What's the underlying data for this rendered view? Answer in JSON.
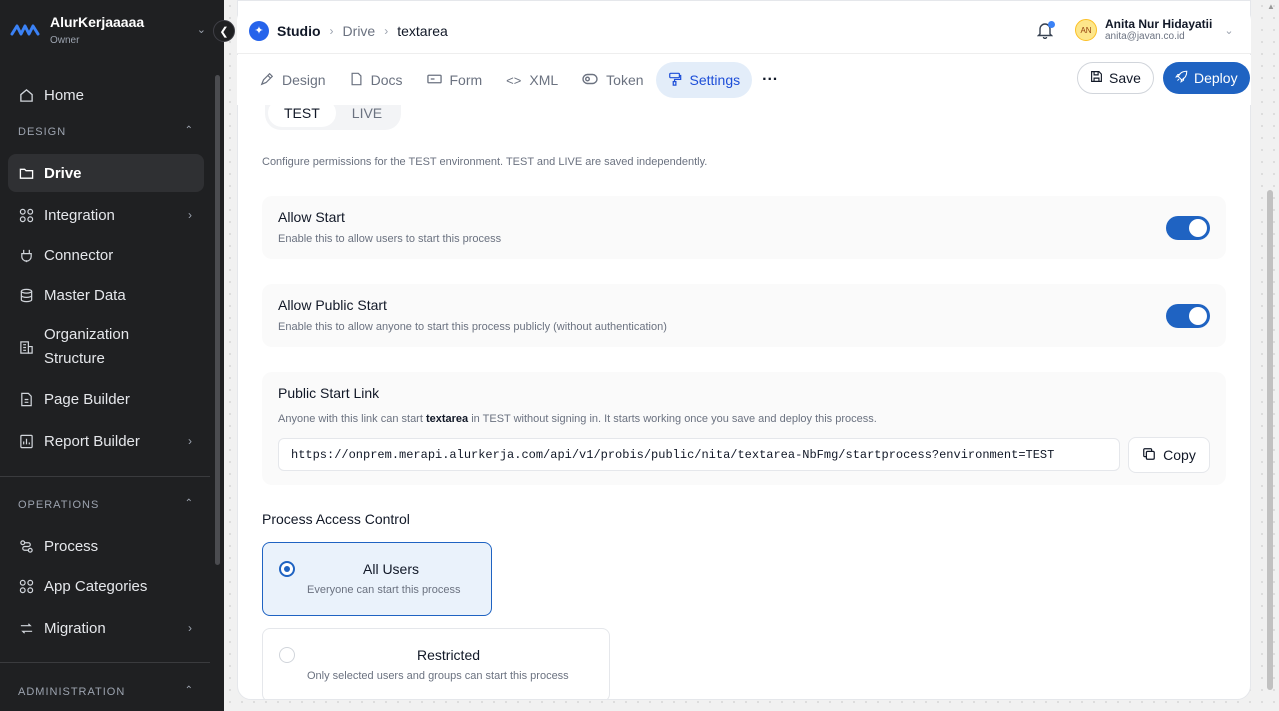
{
  "org": {
    "name": "AlurKerjaaaaa",
    "role": "Owner"
  },
  "sidebar": {
    "home": "Home",
    "design_label": "DESIGN",
    "design_items": [
      {
        "label": "Drive"
      },
      {
        "label": "Integration"
      },
      {
        "label": "Connector"
      },
      {
        "label": "Master Data"
      },
      {
        "label": "Organization Structure"
      },
      {
        "label": "Page Builder"
      },
      {
        "label": "Report Builder"
      }
    ],
    "operations_label": "OPERATIONS",
    "operations_items": [
      {
        "label": "Process"
      },
      {
        "label": "App Categories"
      },
      {
        "label": "Migration"
      }
    ],
    "administration_label": "ADMINISTRATION"
  },
  "breadcrumb": {
    "root": "Studio",
    "parent": "Drive",
    "current": "textarea"
  },
  "user": {
    "name": "Anita Nur Hidayatii",
    "email": "anita@javan.co.id",
    "initials": "AN"
  },
  "tabs": [
    {
      "label": "Design"
    },
    {
      "label": "Docs"
    },
    {
      "label": "Form"
    },
    {
      "label": "XML"
    },
    {
      "label": "Token"
    },
    {
      "label": "Settings"
    }
  ],
  "actions": {
    "save": "Save",
    "deploy": "Deploy"
  },
  "env": {
    "test": "TEST",
    "live": "LIVE"
  },
  "description": "Configure permissions for the TEST environment. TEST and LIVE are saved independently.",
  "allow_start": {
    "title": "Allow Start",
    "subtitle": "Enable this to allow users to start this process",
    "enabled": true
  },
  "allow_public_start": {
    "title": "Allow Public Start",
    "subtitle": "Enable this to allow anyone to start this process publicly (without authentication)",
    "enabled": true
  },
  "public_link": {
    "title": "Public Start Link",
    "subtitle_pre": "Anyone with this link can start ",
    "subtitle_bold": "textarea",
    "subtitle_post": " in TEST without signing in. It starts working once you save and deploy this process.",
    "url": "https://onprem.merapi.alurkerja.com/api/v1/probis/public/nita/textarea-NbFmg/startprocess?environment=TEST",
    "copy": "Copy"
  },
  "access_control": {
    "title": "Process Access Control",
    "options": [
      {
        "title": "All Users",
        "subtitle": "Everyone can start this process",
        "selected": true
      },
      {
        "title": "Restricted",
        "subtitle": "Only selected users and groups can start this process",
        "selected": false
      }
    ]
  },
  "colors": {
    "accent": "#1f63c2",
    "sidebar_bg": "#1f2022"
  }
}
